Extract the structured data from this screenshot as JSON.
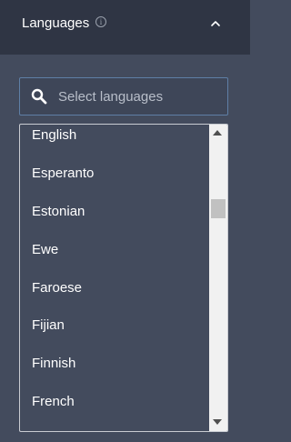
{
  "header": {
    "title": "Languages",
    "info_icon": "info-circle-icon",
    "toggle_icon": "chevron-up-icon"
  },
  "search": {
    "placeholder": "Select languages",
    "value": "",
    "icon": "search-icon"
  },
  "list": {
    "items": [
      "English",
      "Esperanto",
      "Estonian",
      "Ewe",
      "Faroese",
      "Fijian",
      "Finnish",
      "French"
    ]
  },
  "colors": {
    "panel_bg": "#434b5d",
    "header_bg": "#2f3544",
    "search_border": "#5f7fa6",
    "text": "#ffffff",
    "placeholder": "#b8bec9"
  }
}
